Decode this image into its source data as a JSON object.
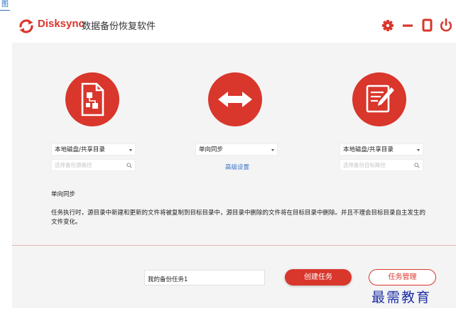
{
  "corner_tag": "图",
  "app": {
    "brand": "Disksync",
    "name": "数据备份恢复软件"
  },
  "window_controls": [
    "gear-icon",
    "minimize-icon",
    "maximize-icon",
    "power-icon"
  ],
  "colors": {
    "accent": "#d9362c",
    "link": "#3a72c9",
    "background": "#f4f4f4",
    "watermark": "#1f2fa8"
  },
  "source": {
    "icon": "document-transfer-icon",
    "type_selected": "本地磁盘/共享目录",
    "path_placeholder": "选择备份源路径"
  },
  "sync": {
    "icon": "double-arrow-icon",
    "mode_selected": "单向同步",
    "advanced_label": "高级设置"
  },
  "target": {
    "icon": "edit-document-icon",
    "type_selected": "本地磁盘/共享目录",
    "path_placeholder": "选择备份目标路径"
  },
  "mode_info": {
    "title": "单向同步",
    "description": "任务执行时，源目录中新建和更新的文件将被复制到目标目录中，源目录中删除的文件将在目标目录中删除。并且不理会目标目录自主发生的文件变化。"
  },
  "footer": {
    "task_name_value": "我的备份任务1",
    "create_label": "创建任务",
    "manage_label": "任务管理"
  },
  "watermark": "最需教育"
}
